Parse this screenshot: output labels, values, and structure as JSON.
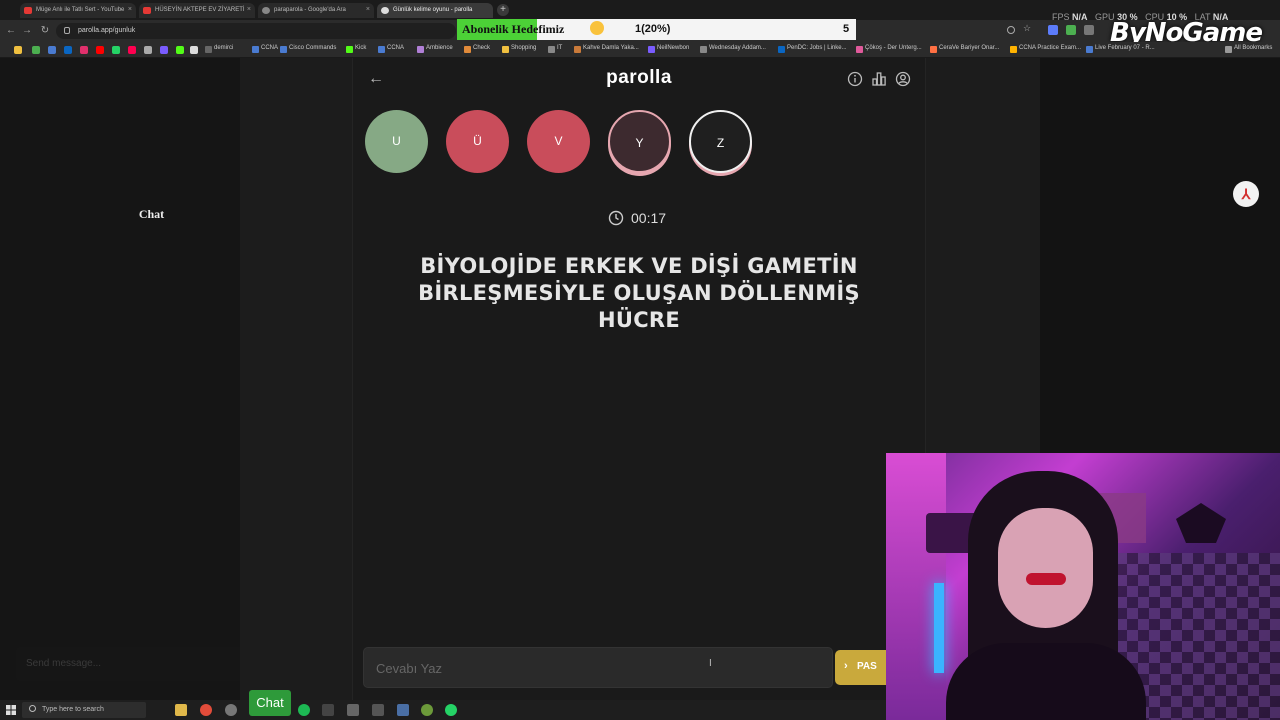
{
  "browser": {
    "tabs": [
      {
        "title": "Müge Anlı ile Tatlı Sert - YouTube"
      },
      {
        "title": "HÜSEYİN AKTEPE EV ZİYARETİ"
      },
      {
        "title": "paraparola - Google'da Ara"
      },
      {
        "title": "Günlük kelime oyunu - parolla"
      }
    ],
    "new_tab": "+",
    "url": "parolla.app/gunluk",
    "bookmarks": [
      "demirci",
      "CCNA",
      "Cisco Commands",
      "Kick",
      "CCNA",
      "Ambience",
      "Check",
      "Shopping",
      "IT",
      "Kahve Damla Yaka...",
      "NeilNewbon",
      "Wednesday Addam...",
      "PenDC: Jobs | Linke...",
      "Çökoş - Der Unterg...",
      "CeraVe Bariyer Onar...",
      "CCNA Practice Exam...",
      "Live February 07 - R...",
      "All Bookmarks"
    ]
  },
  "overlay": {
    "goal_title": "Abonelik Hedefimiz",
    "goal_progress": "1(20%)",
    "goal_fraction": 0.2,
    "goal_target": "5",
    "stats": {
      "fps_label": "FPS",
      "fps": "N/A",
      "gpu_label": "GPU",
      "gpu": "30 %",
      "cpu_label": "CPU",
      "cpu": "10 %",
      "lat_label": "LAT",
      "lat": "N/A"
    },
    "logo": "ByNoGame"
  },
  "chat": {
    "title": "Chat",
    "input_placeholder": "Send message...",
    "button_label": "Chat"
  },
  "app": {
    "title": "parolla",
    "letters": [
      {
        "letter": "U",
        "state": "done"
      },
      {
        "letter": "Ü",
        "state": "wrong"
      },
      {
        "letter": "V",
        "state": "wrong"
      },
      {
        "letter": "Y",
        "state": "current"
      },
      {
        "letter": "Z",
        "state": "next"
      }
    ],
    "timer": "00:17",
    "question": "BİYOLOJİDE ERKEK VE DİŞİ GAMETİN BİRLEŞMESİYLE OLUŞAN DÖLLENMİŞ HÜCRE",
    "answer_placeholder": "Cevabı Yaz",
    "pass_label": "PAS"
  },
  "taskbar": {
    "search_placeholder": "Type here to search"
  },
  "colors": {
    "done": "#86a985",
    "wrong": "#c94d5b",
    "pass": "#c9a93c",
    "goal_fill": "#4cd137"
  }
}
